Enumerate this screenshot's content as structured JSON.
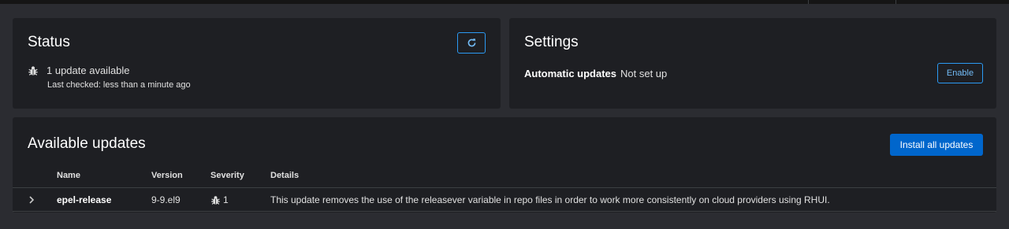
{
  "status": {
    "title": "Status",
    "update_text": "1 update available",
    "last_checked": "Last checked: less than a minute ago",
    "refresh_icon": "refresh-icon",
    "bug_icon": "bug-icon"
  },
  "settings": {
    "title": "Settings",
    "auto_label": "Automatic updates",
    "auto_value": "Not set up",
    "enable_label": "Enable"
  },
  "updates": {
    "title": "Available updates",
    "install_label": "Install all updates",
    "columns": [
      "Name",
      "Version",
      "Severity",
      "Details"
    ],
    "rows": [
      {
        "name": "epel-release",
        "version": "9-9.el9",
        "severity": "1",
        "details": "This update removes the use of the releasever variable in repo files in order to work more consistently on cloud providers using RHUI."
      }
    ]
  },
  "colors": {
    "background": "#2b2c31",
    "card": "#1e1f23",
    "accent": "#2b9af3",
    "primary": "#0066cc"
  }
}
